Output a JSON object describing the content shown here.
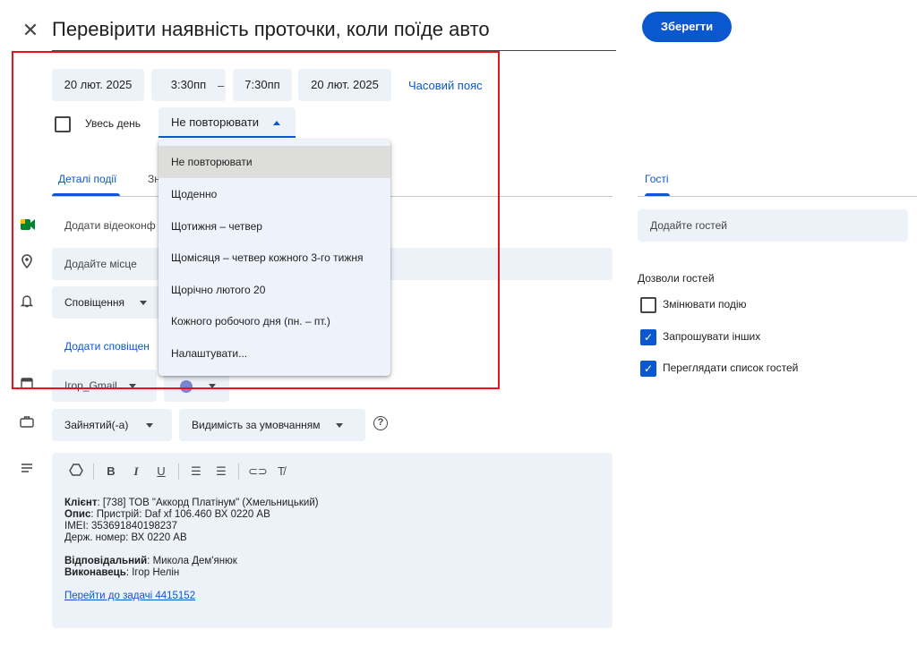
{
  "header": {
    "close_icon": "close-icon",
    "title": "Перевірити наявність проточки, коли поїде авто",
    "save_label": "Зберегти"
  },
  "datetime": {
    "start_date": "20 лют. 2025",
    "start_time": "3:30пп",
    "separator": "–",
    "end_time": "7:30пп",
    "end_date": "20 лют. 2025",
    "timezone_link": "Часовий пояс",
    "all_day_label": "Увесь день",
    "all_day_checked": false,
    "repeat_value": "Не повторювати"
  },
  "repeat_menu": {
    "options": [
      "Не повторювати",
      "Щоденно",
      "Щотижня – четвер",
      "Щомісяця – четвер кожного 3-го тижня",
      "Щорічно лютого 20",
      "Кожного робочого дня (пн. – пт.)",
      "Налаштувати..."
    ],
    "selected_index": 0
  },
  "tabs": {
    "details": "Деталі події",
    "find_time_partial": "Зн",
    "guests": "Гості"
  },
  "details": {
    "video_label": "Додати відеоконф",
    "location_placeholder": "Додайте місце",
    "notification_label": "Сповіщення",
    "add_notification": "Додати сповіщен",
    "calendar_label": "Ігор_Gmail",
    "calendar_color": "#7986cb",
    "availability": "Зайнятий(-а)",
    "visibility": "Видимість за умовчанням",
    "help_icon": "help-icon"
  },
  "description": {
    "client_label": "Клієнт",
    "client_value": ": [738] ТОВ \"Аккорд Платінум\" (Хмельницький)",
    "desc_label": "Опис",
    "desc_value": ": Пристрій: Daf xf 106.460 ВХ 0220 АВ",
    "imei": "IMEI: 353691840198237",
    "plate": "Держ. номер: ВХ 0220 АВ",
    "responsible_label": "Відповідальний",
    "responsible_value": ": Микола Дем'янюк",
    "executor_label": "Виконавець",
    "executor_value": ": Ігор Нелін",
    "task_link": "Перейти до задачі 4415152"
  },
  "guests": {
    "add_placeholder": "Додайте гостей",
    "permissions_title": "Дозволи гостей",
    "permissions": [
      {
        "label": "Змінювати подію",
        "checked": false
      },
      {
        "label": "Запрошувати інших",
        "checked": true
      },
      {
        "label": "Переглядати список гостей",
        "checked": true
      }
    ]
  },
  "colors": {
    "accent": "#0b57d0",
    "field_bg": "#edf1f8",
    "highlight_border": "#e3141b",
    "meet_green": "#00832d",
    "meet_yellow": "#ffba00"
  }
}
